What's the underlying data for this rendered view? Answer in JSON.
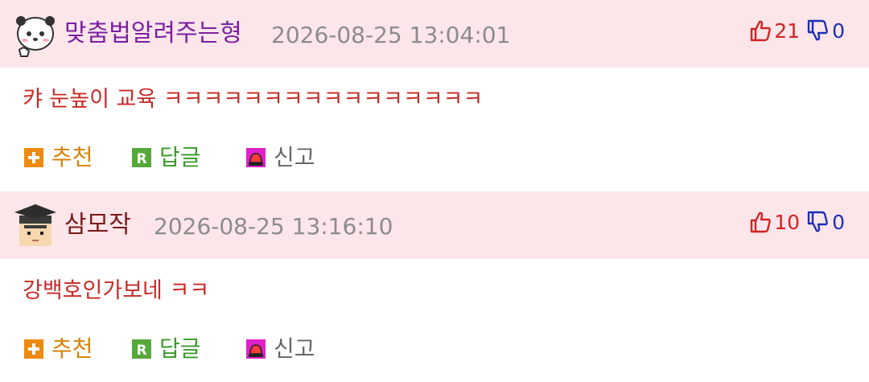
{
  "comments": [
    {
      "nickname": "맞춤법알려주는형",
      "nickname_color": "#7b1fa2",
      "date": "2026-08-25 13:04:01",
      "upvotes": "21",
      "downvotes": "0",
      "text": "캬 눈높이 교육 ㅋㅋㅋㅋㅋㅋㅋㅋㅋㅋㅋㅋㅋㅋㅋㅋ",
      "avatar_icon": "panda-bear-icon"
    },
    {
      "nickname": "삼모작",
      "nickname_color": "#7a1b1b",
      "date": "2026-08-25 13:16:10",
      "upvotes": "10",
      "downvotes": "0",
      "text": "강백호인가보네 ㅋㅋ",
      "avatar_icon": "graduate-cap-icon"
    }
  ],
  "actions": {
    "recommend": "추천",
    "reply": "답글",
    "report": "신고"
  },
  "colors": {
    "header_bg": "#fde6ea",
    "comment_text": "#c72a25",
    "upvote": "#d32222",
    "downvote": "#1d2fb8",
    "recommend": "#d98208",
    "reply": "#3b9a2a",
    "report_icon": "#e020c8"
  }
}
